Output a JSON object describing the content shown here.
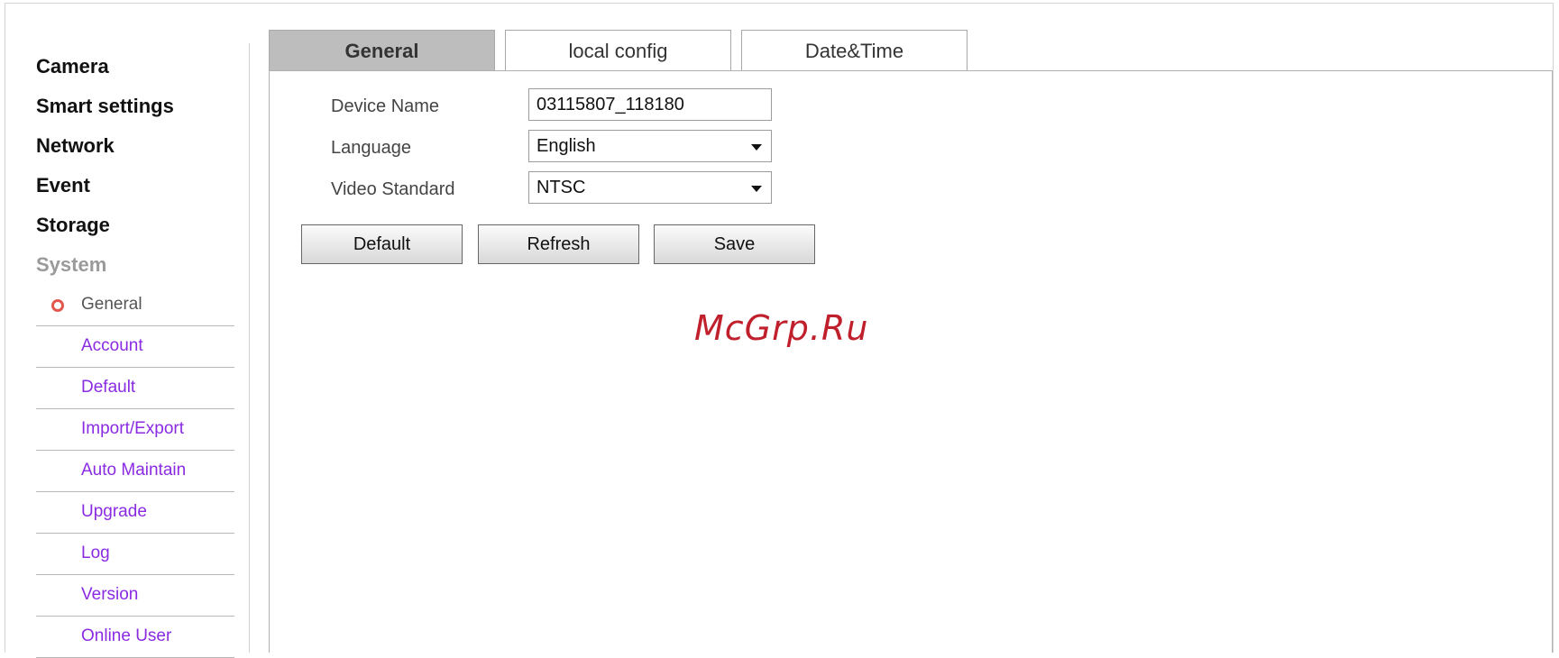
{
  "sidebar": {
    "main_items": [
      "Camera",
      "Smart settings",
      "Network",
      "Event",
      "Storage",
      "System"
    ],
    "sub_items": [
      "General",
      "Account",
      "Default",
      "Import/Export",
      "Auto Maintain",
      "Upgrade",
      "Log",
      "Version",
      "Online User"
    ],
    "active_sub": "General"
  },
  "tabs": [
    "General",
    "local config",
    "Date&Time"
  ],
  "active_tab": "General",
  "form": {
    "device_name_label": "Device Name",
    "device_name_value": "03115807_118180",
    "language_label": "Language",
    "language_value": "English",
    "video_standard_label": "Video Standard",
    "video_standard_value": "NTSC"
  },
  "buttons": {
    "default": "Default",
    "refresh": "Refresh",
    "save": "Save"
  },
  "watermark": "McGrp.Ru",
  "colors": {
    "sub_item_link": "#8a2be2",
    "bullet": "#e2574c",
    "active_tab_bg": "#bdbdbd",
    "watermark": "#c0202c"
  }
}
